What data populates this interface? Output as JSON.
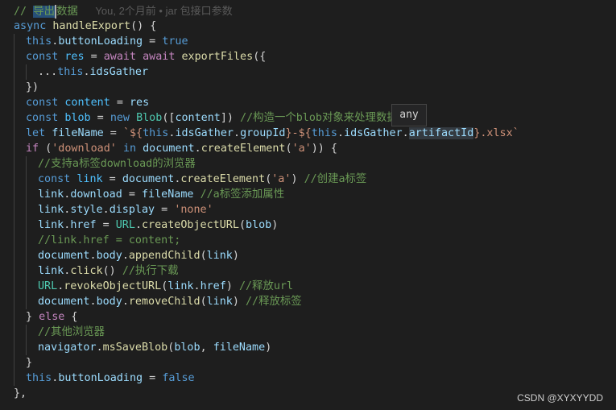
{
  "blame": "You, 2个月前 • jar 包接口参数",
  "tooltip": "any",
  "watermark": "CSDN @XYXYYDD",
  "colors": {
    "background": "#1e1e1e",
    "comment": "#6a9955",
    "keyword": "#569cd6",
    "control": "#c586c0",
    "function": "#dcdcaa",
    "variable": "#9cdcfe",
    "string": "#ce9178",
    "class": "#4ec9b0"
  },
  "lines": [
    {
      "indent": 0,
      "tokens": [
        [
          "comment",
          "// "
        ],
        [
          "comment",
          "导出"
        ],
        [
          "cursor",
          ""
        ],
        [
          "comment",
          "数据"
        ],
        [
          "blame",
          "      You, 2个月前 • jar 包接口参数"
        ]
      ]
    },
    {
      "indent": 0,
      "tokens": [
        [
          "keyword",
          "async"
        ],
        [
          "plain",
          " "
        ],
        [
          "func",
          "handleExport"
        ],
        [
          "plain",
          "() {"
        ]
      ]
    },
    {
      "indent": 1,
      "tokens": [
        [
          "keyword",
          "this"
        ],
        [
          "plain",
          "."
        ],
        [
          "var",
          "buttonLoading"
        ],
        [
          "plain",
          " = "
        ],
        [
          "keyword",
          "true"
        ]
      ]
    },
    {
      "indent": 1,
      "tokens": [
        [
          "keyword",
          "const"
        ],
        [
          "plain",
          " "
        ],
        [
          "const",
          "res"
        ],
        [
          "plain",
          " = "
        ],
        [
          "control",
          "await"
        ],
        [
          "plain",
          " "
        ],
        [
          "control",
          "await"
        ],
        [
          "plain",
          " "
        ],
        [
          "func",
          "exportFiles"
        ],
        [
          "plain",
          "({"
        ]
      ]
    },
    {
      "indent": 2,
      "tokens": [
        [
          "plain",
          "..."
        ],
        [
          "keyword",
          "this"
        ],
        [
          "plain",
          "."
        ],
        [
          "var",
          "idsGather"
        ]
      ]
    },
    {
      "indent": 1,
      "tokens": [
        [
          "plain",
          "})"
        ]
      ]
    },
    {
      "indent": 1,
      "tokens": [
        [
          "keyword",
          "const"
        ],
        [
          "plain",
          " "
        ],
        [
          "const",
          "content"
        ],
        [
          "plain",
          " = "
        ],
        [
          "var",
          "res"
        ]
      ]
    },
    {
      "indent": 1,
      "tokens": [
        [
          "keyword",
          "const"
        ],
        [
          "plain",
          " "
        ],
        [
          "const",
          "blob"
        ],
        [
          "plain",
          " = "
        ],
        [
          "keyword",
          "new"
        ],
        [
          "plain",
          " "
        ],
        [
          "class",
          "Blob"
        ],
        [
          "plain",
          "(["
        ],
        [
          "var",
          "content"
        ],
        [
          "plain",
          "]) "
        ],
        [
          "comment",
          "//构造一个blob对象来处理数据"
        ]
      ]
    },
    {
      "indent": 1,
      "tokens": [
        [
          "keyword",
          "let"
        ],
        [
          "plain",
          " "
        ],
        [
          "var",
          "fileName"
        ],
        [
          "plain",
          " = "
        ],
        [
          "string",
          "`${"
        ],
        [
          "keyword",
          "this"
        ],
        [
          "plain",
          "."
        ],
        [
          "var",
          "idsGather"
        ],
        [
          "plain",
          "."
        ],
        [
          "var",
          "groupId"
        ],
        [
          "string",
          "}-${"
        ],
        [
          "keyword",
          "this"
        ],
        [
          "plain",
          "."
        ],
        [
          "var",
          "idsGather"
        ],
        [
          "plain",
          "."
        ],
        [
          "hl",
          "artifactId"
        ],
        [
          "string",
          "}.xlsx`"
        ]
      ]
    },
    {
      "indent": 1,
      "tokens": [
        [
          "control",
          "if"
        ],
        [
          "plain",
          " ("
        ],
        [
          "string",
          "'download'"
        ],
        [
          "plain",
          " "
        ],
        [
          "keyword",
          "in"
        ],
        [
          "plain",
          " "
        ],
        [
          "var",
          "document"
        ],
        [
          "plain",
          "."
        ],
        [
          "func",
          "createElement"
        ],
        [
          "plain",
          "("
        ],
        [
          "string",
          "'a'"
        ],
        [
          "plain",
          ")) {"
        ]
      ]
    },
    {
      "indent": 2,
      "tokens": [
        [
          "comment",
          "//支持a标签download的浏览器"
        ]
      ]
    },
    {
      "indent": 2,
      "tokens": [
        [
          "keyword",
          "const"
        ],
        [
          "plain",
          " "
        ],
        [
          "const",
          "link"
        ],
        [
          "plain",
          " = "
        ],
        [
          "var",
          "document"
        ],
        [
          "plain",
          "."
        ],
        [
          "func",
          "createElement"
        ],
        [
          "plain",
          "("
        ],
        [
          "string",
          "'a'"
        ],
        [
          "plain",
          ") "
        ],
        [
          "comment",
          "//创建a标签"
        ]
      ]
    },
    {
      "indent": 2,
      "tokens": [
        [
          "var",
          "link"
        ],
        [
          "plain",
          "."
        ],
        [
          "var",
          "download"
        ],
        [
          "plain",
          " = "
        ],
        [
          "var",
          "fileName"
        ],
        [
          "plain",
          " "
        ],
        [
          "comment",
          "//a标签添加属性"
        ]
      ]
    },
    {
      "indent": 2,
      "tokens": [
        [
          "var",
          "link"
        ],
        [
          "plain",
          "."
        ],
        [
          "var",
          "style"
        ],
        [
          "plain",
          "."
        ],
        [
          "var",
          "display"
        ],
        [
          "plain",
          " = "
        ],
        [
          "string",
          "'none'"
        ]
      ]
    },
    {
      "indent": 2,
      "tokens": [
        [
          "var",
          "link"
        ],
        [
          "plain",
          "."
        ],
        [
          "var",
          "href"
        ],
        [
          "plain",
          " = "
        ],
        [
          "class",
          "URL"
        ],
        [
          "plain",
          "."
        ],
        [
          "func",
          "createObjectURL"
        ],
        [
          "plain",
          "("
        ],
        [
          "var",
          "blob"
        ],
        [
          "plain",
          ")"
        ]
      ]
    },
    {
      "indent": 2,
      "tokens": [
        [
          "comment",
          "//link.href = content;"
        ]
      ]
    },
    {
      "indent": 2,
      "tokens": [
        [
          "var",
          "document"
        ],
        [
          "plain",
          "."
        ],
        [
          "var",
          "body"
        ],
        [
          "plain",
          "."
        ],
        [
          "func",
          "appendChild"
        ],
        [
          "plain",
          "("
        ],
        [
          "var",
          "link"
        ],
        [
          "plain",
          ")"
        ]
      ]
    },
    {
      "indent": 2,
      "tokens": [
        [
          "var",
          "link"
        ],
        [
          "plain",
          "."
        ],
        [
          "func",
          "click"
        ],
        [
          "plain",
          "() "
        ],
        [
          "comment",
          "//执行下载"
        ]
      ]
    },
    {
      "indent": 2,
      "tokens": [
        [
          "class",
          "URL"
        ],
        [
          "plain",
          "."
        ],
        [
          "func",
          "revokeObjectURL"
        ],
        [
          "plain",
          "("
        ],
        [
          "var",
          "link"
        ],
        [
          "plain",
          "."
        ],
        [
          "var",
          "href"
        ],
        [
          "plain",
          ") "
        ],
        [
          "comment",
          "//释放url"
        ]
      ]
    },
    {
      "indent": 2,
      "tokens": [
        [
          "var",
          "document"
        ],
        [
          "plain",
          "."
        ],
        [
          "var",
          "body"
        ],
        [
          "plain",
          "."
        ],
        [
          "func",
          "removeChild"
        ],
        [
          "plain",
          "("
        ],
        [
          "var",
          "link"
        ],
        [
          "plain",
          ") "
        ],
        [
          "comment",
          "//释放标签"
        ]
      ]
    },
    {
      "indent": 1,
      "tokens": [
        [
          "plain",
          "} "
        ],
        [
          "control",
          "else"
        ],
        [
          "plain",
          " {"
        ]
      ]
    },
    {
      "indent": 2,
      "tokens": [
        [
          "comment",
          "//其他浏览器"
        ]
      ]
    },
    {
      "indent": 2,
      "tokens": [
        [
          "var",
          "navigator"
        ],
        [
          "plain",
          "."
        ],
        [
          "func",
          "msSaveBlob"
        ],
        [
          "plain",
          "("
        ],
        [
          "var",
          "blob"
        ],
        [
          "plain",
          ", "
        ],
        [
          "var",
          "fileName"
        ],
        [
          "plain",
          ")"
        ]
      ]
    },
    {
      "indent": 1,
      "tokens": [
        [
          "plain",
          "}"
        ]
      ]
    },
    {
      "indent": 1,
      "tokens": [
        [
          "keyword",
          "this"
        ],
        [
          "plain",
          "."
        ],
        [
          "var",
          "buttonLoading"
        ],
        [
          "plain",
          " = "
        ],
        [
          "keyword",
          "false"
        ]
      ]
    },
    {
      "indent": 0,
      "tokens": [
        [
          "plain",
          "},"
        ]
      ]
    }
  ]
}
